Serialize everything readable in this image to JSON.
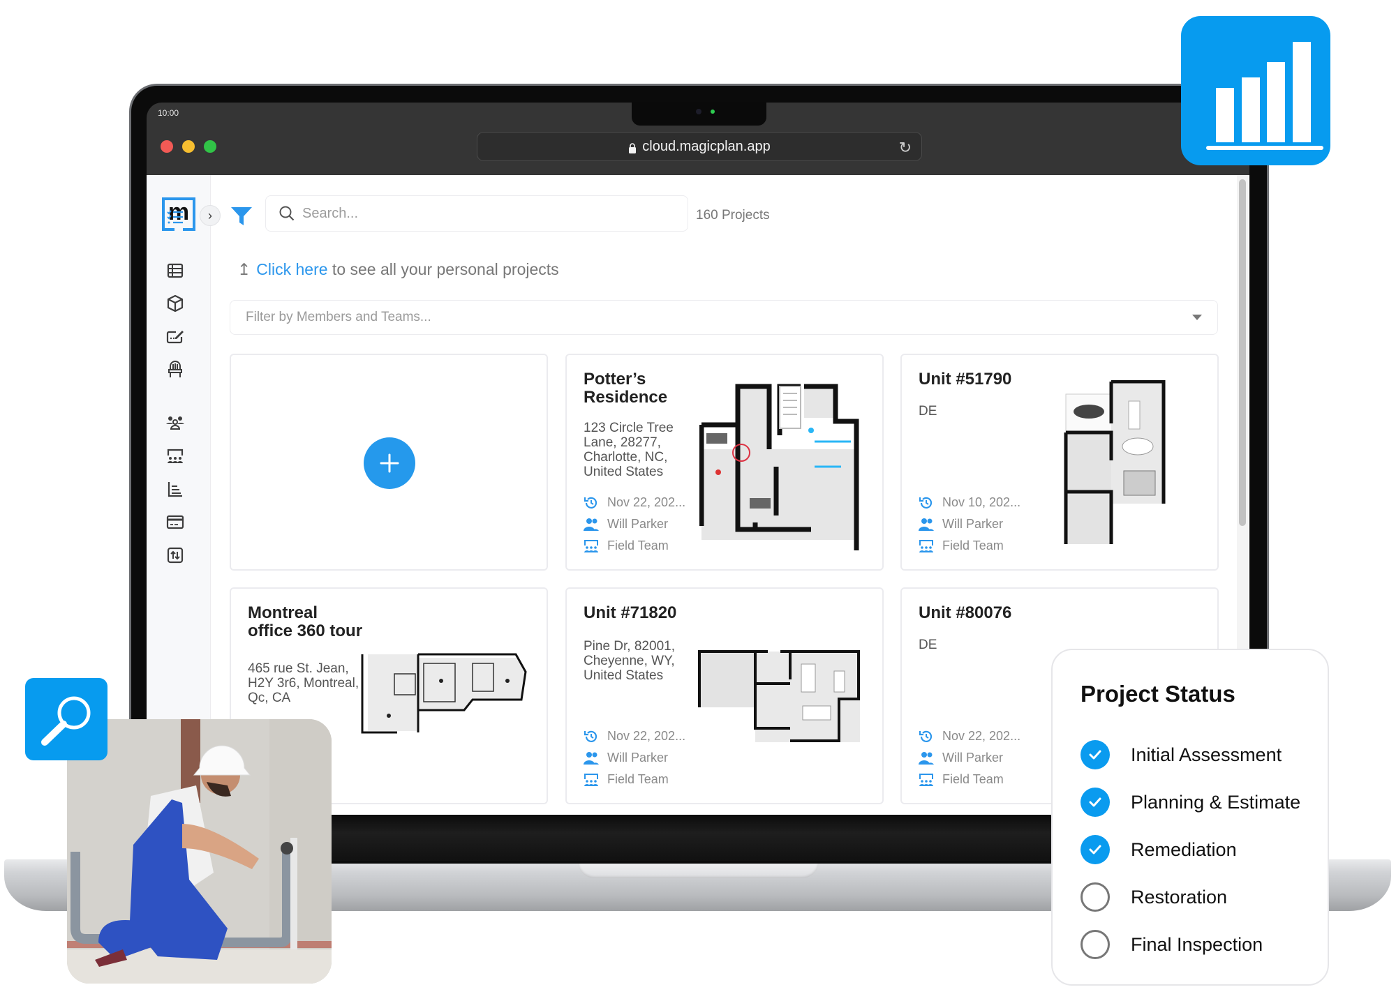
{
  "browser": {
    "clock": "10:00",
    "url": "cloud.magicplan.app"
  },
  "app": {
    "logo_letter": "m",
    "search": {
      "placeholder": "Search...",
      "value": ""
    },
    "project_count": "160 Projects",
    "personal_hint": {
      "link": "Click here",
      "rest": " to see all your personal projects"
    },
    "member_filter": {
      "placeholder": "Filter by Members and Teams..."
    },
    "sidebar": {
      "items": [
        {
          "name": "projects-list",
          "icon": "checklist-icon"
        },
        {
          "name": "table-view",
          "icon": "table-icon"
        },
        {
          "name": "3d-objects",
          "icon": "cube-icon"
        },
        {
          "name": "forms",
          "icon": "edit-form-icon"
        },
        {
          "name": "furniture",
          "icon": "chair-icon"
        },
        {
          "name": "members",
          "icon": "members-icon"
        },
        {
          "name": "teams",
          "icon": "teams-icon"
        },
        {
          "name": "reports",
          "icon": "report-icon"
        },
        {
          "name": "billing",
          "icon": "credit-card-icon"
        },
        {
          "name": "import-export",
          "icon": "import-export-icon"
        }
      ]
    },
    "cards": [
      {
        "title": "Potter’s Residence",
        "address": "123 Circle Tree Lane, 28277, Charlotte, NC, United States",
        "date": "Nov 22, 202...",
        "owner": "Will Parker",
        "team": "Field Team"
      },
      {
        "title": "Unit #51790",
        "address": "DE",
        "date": "Nov 10, 202...",
        "owner": "Will Parker",
        "team": "Field Team"
      },
      {
        "title": "Montreal office 360 tour",
        "address": "465 rue St. Jean, H2Y 3r6, Montreal, Qc, CA"
      },
      {
        "title": "Unit #71820",
        "address": "Pine Dr, 82001, Cheyenne, WY, United States",
        "date": "Nov 22, 202...",
        "owner": "Will Parker",
        "team": "Field Team"
      },
      {
        "title": "Unit #80076",
        "address": "DE",
        "date": "Nov 22, 202...",
        "owner": "Will Parker",
        "team": "Field Team"
      }
    ]
  },
  "project_status": {
    "heading": "Project Status",
    "steps": [
      {
        "label": "Initial Assessment",
        "done": true
      },
      {
        "label": "Planning & Estimate",
        "done": true
      },
      {
        "label": "Remediation",
        "done": true
      },
      {
        "label": "Restoration",
        "done": false
      },
      {
        "label": "Final Inspection",
        "done": false
      }
    ]
  },
  "colors": {
    "accent": "#2b96ec",
    "badge_blue": "#079bef",
    "check_blue": "#0a9bef"
  }
}
